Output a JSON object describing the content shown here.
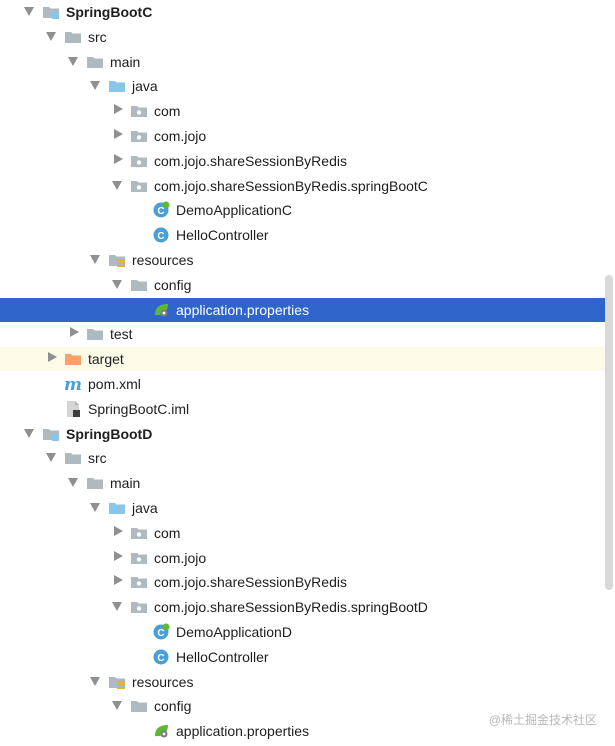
{
  "tree": [
    {
      "label": "SpringBootC",
      "depth": 0,
      "arrow": "open",
      "icon": "module-icon",
      "bold": true
    },
    {
      "label": "src",
      "depth": 1,
      "arrow": "open",
      "icon": "folder-icon"
    },
    {
      "label": "main",
      "depth": 2,
      "arrow": "open",
      "icon": "folder-icon"
    },
    {
      "label": "java",
      "depth": 3,
      "arrow": "open",
      "icon": "source-folder-icon"
    },
    {
      "label": "com",
      "depth": 4,
      "arrow": "closed",
      "icon": "package-icon"
    },
    {
      "label": "com.jojo",
      "depth": 4,
      "arrow": "closed",
      "icon": "package-icon"
    },
    {
      "label": "com.jojo.shareSessionByRedis",
      "depth": 4,
      "arrow": "closed",
      "icon": "package-icon"
    },
    {
      "label": "com.jojo.shareSessionByRedis.springBootC",
      "depth": 4,
      "arrow": "open",
      "icon": "package-icon"
    },
    {
      "label": "DemoApplicationC",
      "depth": 5,
      "arrow": "none",
      "icon": "spring-boot-class-icon"
    },
    {
      "label": "HelloController",
      "depth": 5,
      "arrow": "none",
      "icon": "class-icon"
    },
    {
      "label": "resources",
      "depth": 3,
      "arrow": "open",
      "icon": "resources-folder-icon"
    },
    {
      "label": "config",
      "depth": 4,
      "arrow": "open",
      "icon": "folder-icon"
    },
    {
      "label": "application.properties",
      "depth": 5,
      "arrow": "none",
      "icon": "spring-properties-icon",
      "selected": true
    },
    {
      "label": "test",
      "depth": 2,
      "arrow": "closed",
      "icon": "folder-icon"
    },
    {
      "label": "target",
      "depth": 1,
      "arrow": "closed",
      "icon": "excluded-folder-icon",
      "excluded": true
    },
    {
      "label": "pom.xml",
      "depth": 1,
      "arrow": "none",
      "icon": "maven-icon"
    },
    {
      "label": "SpringBootC.iml",
      "depth": 1,
      "arrow": "none",
      "icon": "iml-file-icon"
    },
    {
      "label": "SpringBootD",
      "depth": 0,
      "arrow": "open",
      "icon": "module-icon",
      "bold": true
    },
    {
      "label": "src",
      "depth": 1,
      "arrow": "open",
      "icon": "folder-icon"
    },
    {
      "label": "main",
      "depth": 2,
      "arrow": "open",
      "icon": "folder-icon"
    },
    {
      "label": "java",
      "depth": 3,
      "arrow": "open",
      "icon": "source-folder-icon"
    },
    {
      "label": "com",
      "depth": 4,
      "arrow": "closed",
      "icon": "package-icon"
    },
    {
      "label": "com.jojo",
      "depth": 4,
      "arrow": "closed",
      "icon": "package-icon"
    },
    {
      "label": "com.jojo.shareSessionByRedis",
      "depth": 4,
      "arrow": "closed",
      "icon": "package-icon"
    },
    {
      "label": "com.jojo.shareSessionByRedis.springBootD",
      "depth": 4,
      "arrow": "open",
      "icon": "package-icon"
    },
    {
      "label": "DemoApplicationD",
      "depth": 5,
      "arrow": "none",
      "icon": "spring-boot-class-icon"
    },
    {
      "label": "HelloController",
      "depth": 5,
      "arrow": "none",
      "icon": "class-icon"
    },
    {
      "label": "resources",
      "depth": 3,
      "arrow": "open",
      "icon": "resources-folder-icon"
    },
    {
      "label": "config",
      "depth": 4,
      "arrow": "open",
      "icon": "folder-icon"
    },
    {
      "label": "application.properties",
      "depth": 5,
      "arrow": "none",
      "icon": "spring-properties-icon"
    }
  ],
  "watermark": "@稀土掘金技术社区",
  "colors": {
    "selection": "#2f65ca",
    "excluded_row": "#fcfbe8",
    "folder": "#aeb9c0",
    "source_folder": "#87c6e8",
    "excluded_folder": "#f4a46a",
    "class_circle": "#4a9fd6",
    "spring_green": "#5fb832",
    "maven": "#4a9fd6"
  }
}
